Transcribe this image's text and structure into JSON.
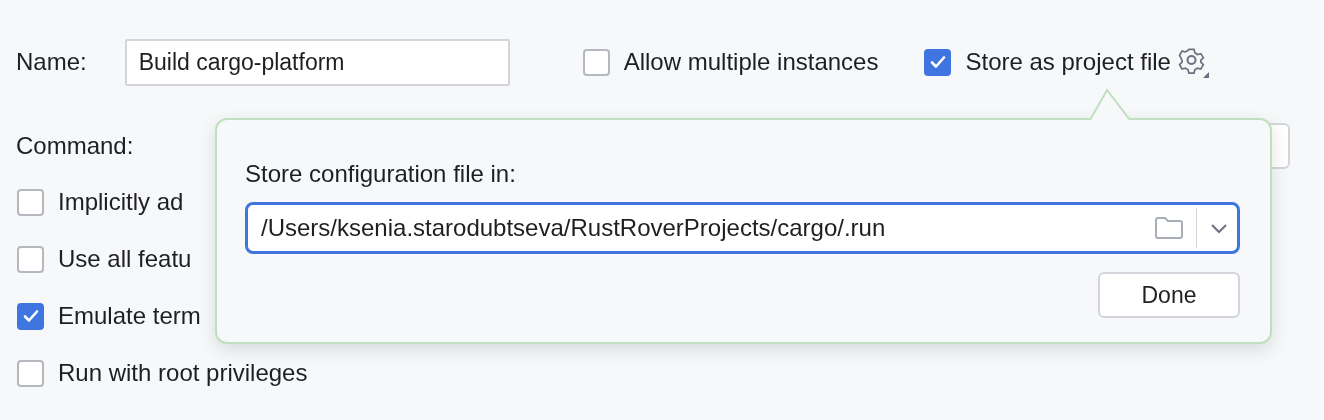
{
  "name_field": {
    "label": "Name:",
    "value": "Build cargo-platform"
  },
  "header_options": [
    {
      "label": "Allow multiple instances",
      "checked": false
    },
    {
      "label": "Store as project file",
      "checked": true
    }
  ],
  "command": {
    "label": "Command:"
  },
  "options": [
    {
      "label": "Implicitly ad",
      "checked": false
    },
    {
      "label": "Use all featu",
      "checked": false
    },
    {
      "label": "Emulate term",
      "checked": true
    },
    {
      "label": "Run with root privileges",
      "checked": false
    }
  ],
  "popup": {
    "label": "Store configuration file in:",
    "path": "/Users/ksenia.starodubtseva/RustRoverProjects/cargo/.run",
    "button": "Done"
  }
}
